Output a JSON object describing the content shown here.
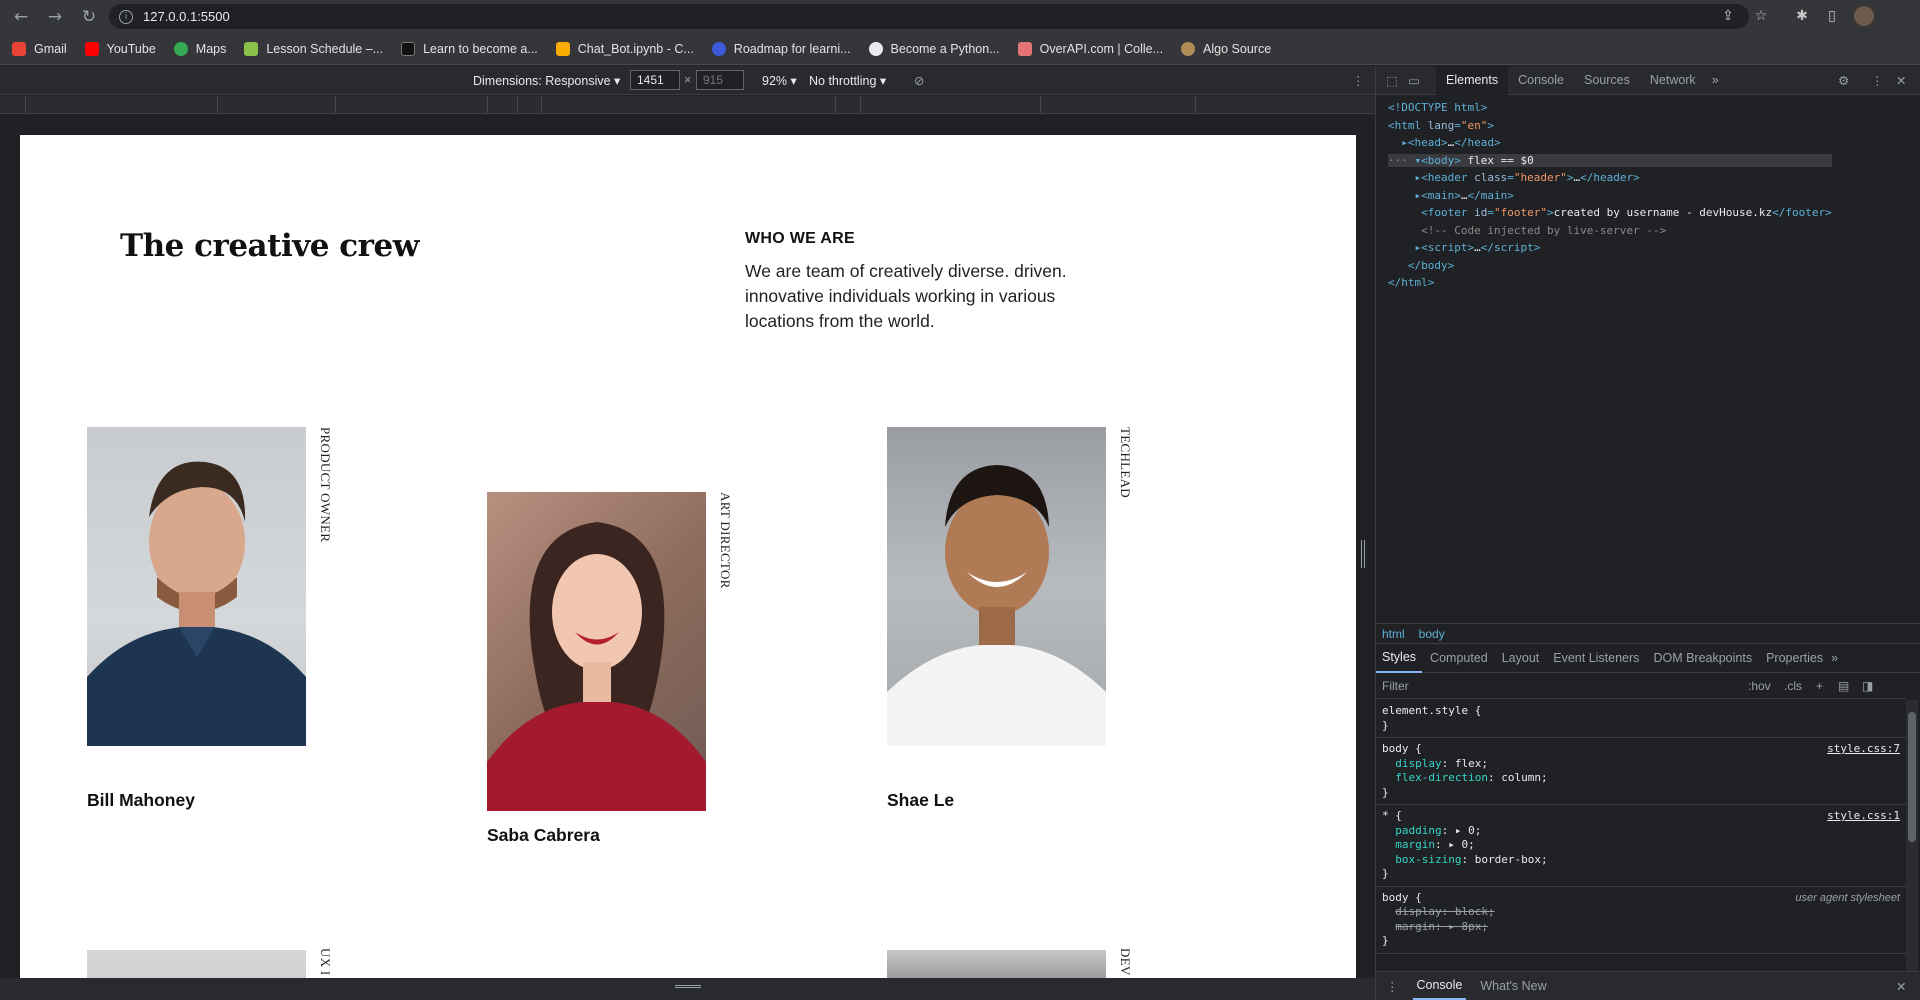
{
  "browser": {
    "url": "127.0.0.1:5500",
    "bookmarks": [
      {
        "label": "Gmail",
        "color": "#ea4335"
      },
      {
        "label": "YouTube",
        "color": "#ff0000"
      },
      {
        "label": "Maps",
        "color": "#34a853"
      },
      {
        "label": "Lesson Schedule –...",
        "color": "#8bc34a"
      },
      {
        "label": "Learn to become a...",
        "color": "#111111"
      },
      {
        "label": "Chat_Bot.ipynb - C...",
        "color": "#f9ab00"
      },
      {
        "label": "Roadmap for learni...",
        "color": "#3b5bdb"
      },
      {
        "label": "Become a Python...",
        "color": "#e8eaed"
      },
      {
        "label": "OverAPI.com | Colle...",
        "color": "#e57373"
      },
      {
        "label": "Algo Source",
        "color": "#b08d57"
      }
    ]
  },
  "device_toolbar": {
    "dimensions_label": "Dimensions: Responsive",
    "width": "1451",
    "height": "915",
    "separator": "×",
    "zoom": "92%",
    "throttle": "No throttling"
  },
  "page": {
    "title": "The creative crew",
    "who_title": "WHO WE ARE",
    "who_text": "We are team of creatively diverse. driven. innovative individuals working in various locations from the world.",
    "members": [
      {
        "name": "Bill Mahoney",
        "role": "PRODUCT OWNER"
      },
      {
        "name": "Saba Cabrera",
        "role": "ART DIRECTOR"
      },
      {
        "name": "Shae Le",
        "role": "TECHLEAD"
      }
    ],
    "partial_roles": [
      "UX I",
      "DEV"
    ]
  },
  "devtools": {
    "tabs": [
      "Elements",
      "Console",
      "Sources",
      "Network"
    ],
    "active_tab": "Elements",
    "crumbs": [
      "html",
      "body"
    ],
    "style_tabs": [
      "Styles",
      "Computed",
      "Layout",
      "Event Listeners",
      "DOM Breakpoints",
      "Properties"
    ],
    "filter_placeholder": "Filter",
    "hov": ":hov",
    "cls": ".cls",
    "drawer_tabs": [
      "Console",
      "What's New"
    ],
    "rule_sources": [
      "style.css:7",
      "style.css:1"
    ],
    "ua_label": "user agent stylesheet",
    "footer_text": "created by username - devHouse.kz"
  },
  "colors": {
    "chrome_bg": "#35363a",
    "devtools_bg": "#202124",
    "page_bg": "#ffffff",
    "accent": "#8ab4f8"
  }
}
